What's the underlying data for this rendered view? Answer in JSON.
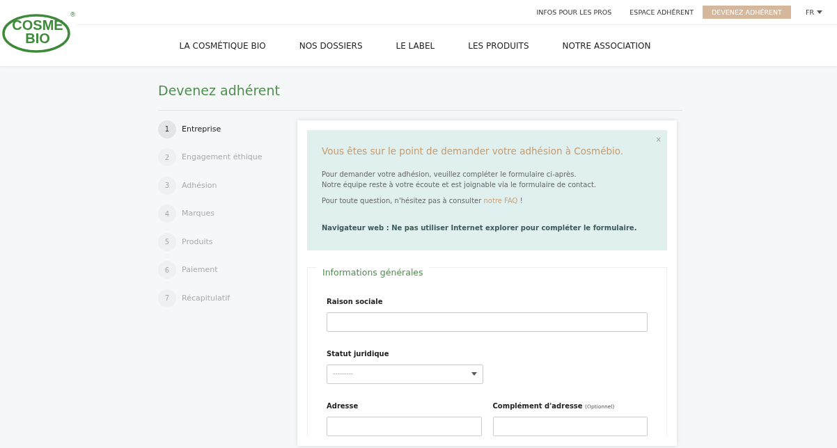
{
  "logo": {
    "lines": [
      "COSME",
      "BIO"
    ],
    "mark": "®"
  },
  "top_links": [
    {
      "label": "INFOS POUR LES PROS",
      "highlighted": false
    },
    {
      "label": "ESPACE ADHÉRENT",
      "highlighted": false
    },
    {
      "label": "DEVENEZ ADHÉRENT",
      "highlighted": true
    }
  ],
  "language": "FR",
  "main_nav": [
    "LA COSMÉTIQUE BIO",
    "NOS DOSSIERS",
    "LE LABEL",
    "LES PRODUITS",
    "NOTRE ASSOCIATION"
  ],
  "page_title": "Devenez adhérent",
  "steps": [
    {
      "number": "1",
      "label": "Entreprise",
      "selected": true
    },
    {
      "number": "2",
      "label": "Engagement éthique",
      "selected": false
    },
    {
      "number": "3",
      "label": "Adhésion",
      "selected": false
    },
    {
      "number": "4",
      "label": "Marques",
      "selected": false
    },
    {
      "number": "5",
      "label": "Produits",
      "selected": false
    },
    {
      "number": "6",
      "label": "Paiement",
      "selected": false
    },
    {
      "number": "7",
      "label": "Récapitulatif",
      "selected": false
    }
  ],
  "alert": {
    "close": "×",
    "heading": "Vous êtes sur le point de demander votre adhésion à Cosmébio.",
    "lines": [
      "Pour demander votre adhésion, veuillez compléter le formulaire ci-après.",
      "Notre équipe reste à votre écoute et est joignable via le formulaire de contact."
    ],
    "faq_text": "Pour toute question, n'hésitez pas à consulter",
    "faq_link": "notre FAQ",
    "faq_end": "!",
    "warning": "Navigateur web : Ne pas utiliser Internet explorer pour compléter le formulaire."
  },
  "section": {
    "legend": "Informations générales",
    "rows": [
      [
        {
          "kind": "text",
          "label": "Raison sociale"
        }
      ],
      [
        {
          "kind": "select",
          "label": "Statut juridique",
          "value": "---------"
        }
      ],
      [
        {
          "kind": "text",
          "label": "Adresse"
        },
        {
          "kind": "text",
          "label": "Complément d'adresse",
          "note": "(Optionnel)"
        }
      ]
    ]
  }
}
